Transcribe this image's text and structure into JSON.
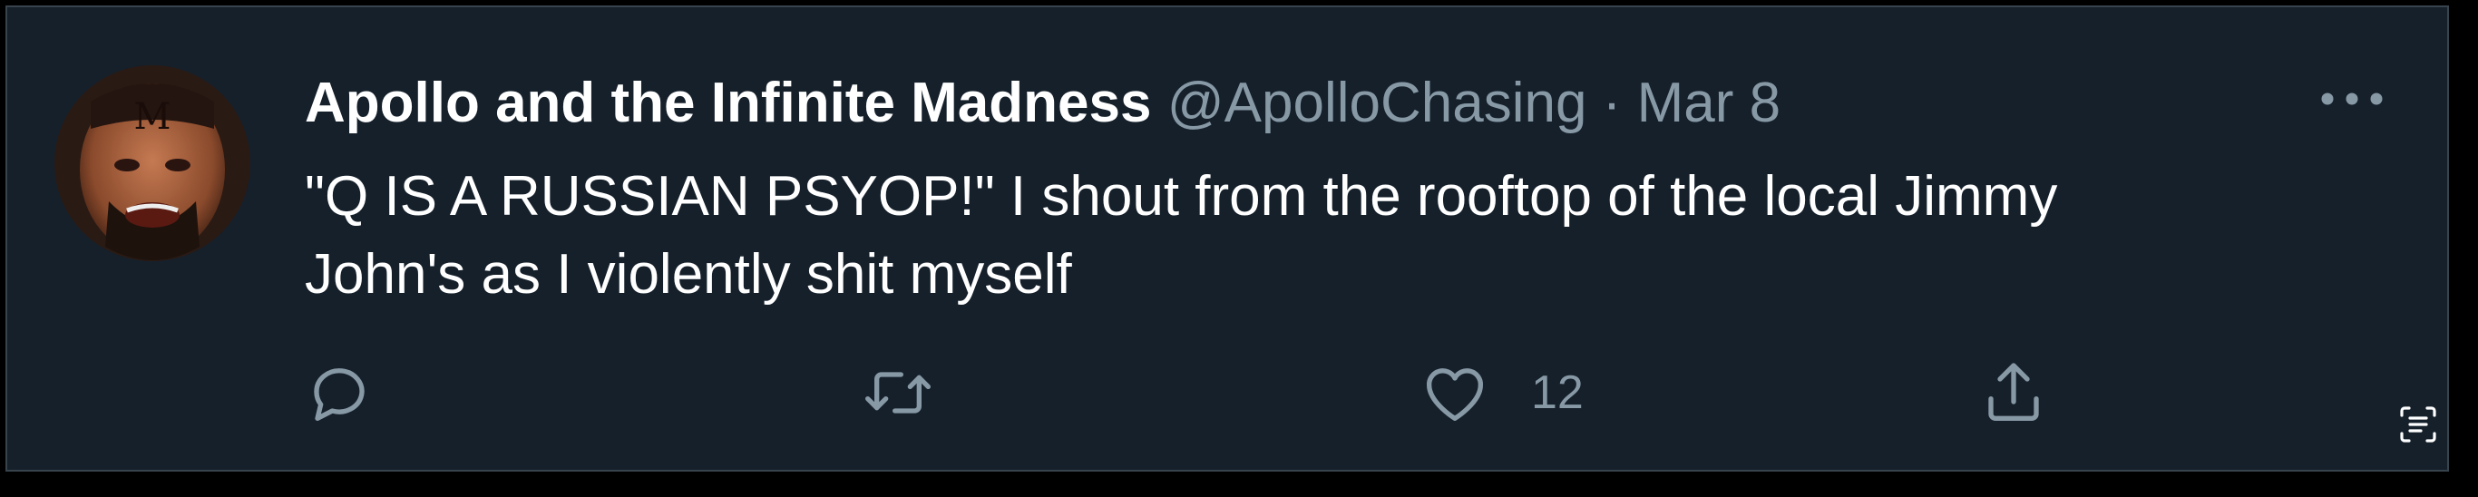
{
  "tweet": {
    "author_name": "Apollo and the Infinite Madness",
    "author_handle": "@ApolloChasing",
    "separator": "·",
    "date": "Mar 8",
    "text_line1": "\"Q IS A RUSSIAN PSYOP!\" I shout from the rooftop of the local Jimmy",
    "text_line2": "John's as I violently shit myself",
    "like_count": "12",
    "avatar_emblem": "M"
  },
  "actions": [
    {
      "name": "reply",
      "icon": "reply-icon"
    },
    {
      "name": "retweet",
      "icon": "retweet-icon"
    },
    {
      "name": "like",
      "icon": "heart-icon"
    },
    {
      "name": "share",
      "icon": "share-icon"
    }
  ],
  "colors": {
    "page_background": "#000000",
    "tweet_background": "#15202b",
    "primary_text": "#ffffff",
    "secondary_text": "#8899a6"
  }
}
